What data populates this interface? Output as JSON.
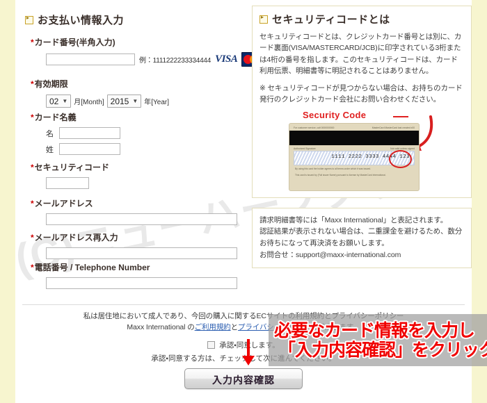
{
  "page": {
    "gutter_color": "#f7f5cf",
    "watermark_text": "(C)ニューハーフクラブドットコム"
  },
  "left_panel": {
    "heading": "お支払い情報入力",
    "heading_icon": "expand-box-icon",
    "fields": {
      "card_number": {
        "label": "カード番号(半角入力)",
        "required_mark": "*",
        "value": "",
        "placeholder": "",
        "example": "例：1111222233334444",
        "brand_visa": "VISA",
        "brand_mastercard": "MasterCard"
      },
      "expiry": {
        "label": "有効期限",
        "required_mark": "*",
        "month_value": "02",
        "month_unit": "月[Month]",
        "year_value": "2015",
        "year_unit": "年[Year]",
        "caret": "▼"
      },
      "card_name": {
        "label": "カード名義",
        "required_mark": "*",
        "first_label": "名",
        "first_value": "",
        "last_label": "姓",
        "last_value": ""
      },
      "security_code": {
        "label": "セキュリティコード",
        "required_mark": "*",
        "value": ""
      },
      "email": {
        "label": "メールアドレス",
        "required_mark": "*",
        "value": ""
      },
      "email_confirm": {
        "label": "メールアドレス再入力",
        "required_mark": "*",
        "value": ""
      },
      "telephone": {
        "label": "電話番号 / Telephone Number",
        "required_mark": "*",
        "value": ""
      }
    }
  },
  "right_panel": {
    "heading": "セキュリティコードとは",
    "heading_icon": "expand-box-icon",
    "paragraph1": "セキュリティコードとは、クレジットカード番号とは別に、カード裏面(VISA/MASTERCARD/JCB)に印字されている3桁または4桁の番号を指します。このセキュリティコードは、カード利用伝票、明細書等に明記されることはありません。",
    "paragraph2": "※ セキュリティコードが見つからない場合は、お持ちのカード発行のクレジットカード会社にお問い合わせください。",
    "card_figure": {
      "callout_label": "Security Code",
      "card_top_left": "For customer service, call 0000000000",
      "card_top_right": "MasterCard    MasterCard last  created   x00",
      "card_sig_left": "Authorized Signature",
      "card_sig_right": "Not valid unless signed",
      "card_digits": "1111 2222 3333 4444 123",
      "card_fine1": "By using this card the holder agrees to all terms under which it was issued.",
      "card_fine2": "This card is issued by (Full issuer Name) pursuant to license by MasterCard International."
    },
    "notice": {
      "line1": "請求明細書等には「Maxx International」と表記されます。",
      "line2": "認証結果が表示されない場合は、二重課金を避けるため、数分お待ちになって再決済をお願いします。",
      "line3": "お問合せ：support@maxx-international.com"
    }
  },
  "agreement": {
    "line1_pre": "私は居住地において成人であり、今回の購入に関するECサイトの",
    "line1_post": "利用規約とプライバシーポリシー",
    "line2_pre": "Maxx International の",
    "line2_link1": "ご利用規約",
    "line2_mid": "と",
    "line2_link2": "プライバシーポリシー",
    "line2_post": "に同意します。",
    "checkbox_label": "承認・同意します。",
    "checkbox_checked": false,
    "note": "承認・同意する方は、チェックして次に進んでください。"
  },
  "submit": {
    "label": "入力内容確認"
  },
  "callout": {
    "line1": "必要なカード情報を入力し",
    "line2": "「入力内容確認」をクリック",
    "color": "#f00000",
    "arrow": "down-arrow-icon"
  }
}
